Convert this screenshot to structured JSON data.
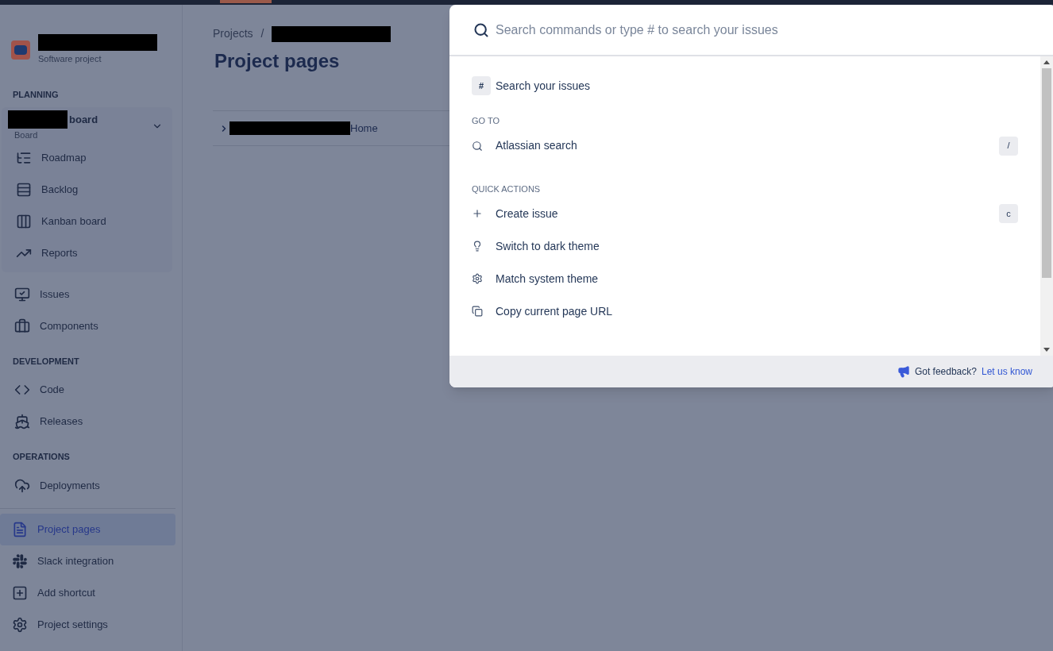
{
  "sidebar": {
    "project": {
      "subtitle": "Software project"
    },
    "planning": {
      "heading": "PLANNING",
      "board": {
        "label": "board",
        "subtitle": "Board",
        "expanded": true
      },
      "items": [
        {
          "kind": "roadmap",
          "label": "Roadmap",
          "selected": false
        },
        {
          "kind": "backlog",
          "label": "Backlog",
          "selected": false
        },
        {
          "kind": "kanban",
          "label": "Kanban board",
          "selected": false
        },
        {
          "kind": "reports",
          "label": "Reports",
          "selected": false
        }
      ]
    },
    "items": [
      {
        "kind": "issues",
        "label": "Issues",
        "selected": false
      },
      {
        "kind": "components",
        "label": "Components",
        "selected": false
      }
    ],
    "sections": [
      {
        "heading": "DEVELOPMENT",
        "items": [
          {
            "kind": "code",
            "label": "Code",
            "selected": false
          },
          {
            "kind": "releases",
            "label": "Releases",
            "selected": false
          }
        ]
      },
      {
        "heading": "OPERATIONS",
        "items": [
          {
            "kind": "deployments",
            "label": "Deployments",
            "selected": false
          }
        ]
      }
    ],
    "bottom_items": [
      {
        "kind": "pages",
        "label": "Project pages",
        "selected": true
      },
      {
        "kind": "slack",
        "label": "Slack integration",
        "selected": false
      },
      {
        "kind": "shortcut",
        "label": "Add shortcut",
        "selected": false
      },
      {
        "kind": "settings",
        "label": "Project settings",
        "selected": false
      }
    ]
  },
  "main": {
    "breadcrumbs": [
      "Projects",
      "/"
    ],
    "title": "Project pages",
    "rows": [
      {
        "label": "Home",
        "expanded": false
      }
    ]
  },
  "command_palette": {
    "search": {
      "placeholder": "Search commands or type # to search your issues"
    },
    "items": [
      {
        "kind": "hash",
        "key": "#",
        "label": "Search your issues"
      }
    ],
    "sections": [
      {
        "heading": "GO TO",
        "items": [
          {
            "kind": "search",
            "label": "Atlassian search",
            "shortcut": "/"
          }
        ]
      },
      {
        "heading": "QUICK ACTIONS",
        "items": [
          {
            "kind": "create",
            "label": "Create issue",
            "shortcut": "c"
          },
          {
            "kind": "theme",
            "label": "Switch to dark theme"
          },
          {
            "kind": "system",
            "label": "Match system theme"
          },
          {
            "kind": "copy",
            "label": "Copy current page URL"
          }
        ]
      }
    ],
    "footer": {
      "question": "Got feedback?",
      "link": "Let us know"
    }
  }
}
